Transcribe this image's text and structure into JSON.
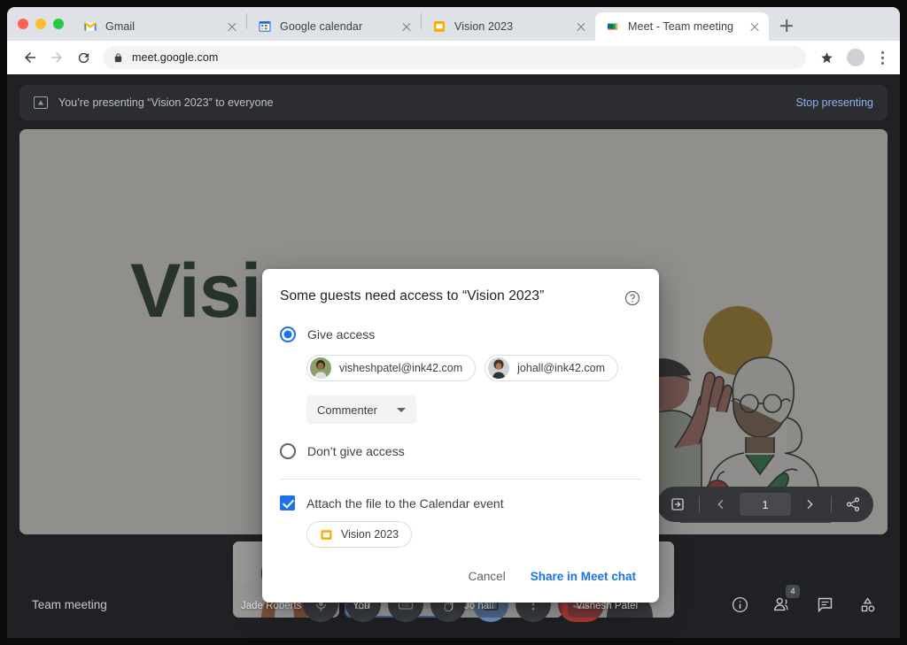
{
  "browser": {
    "tabs": [
      {
        "title": "Gmail",
        "icon": "gmail-icon",
        "active": false
      },
      {
        "title": "Google calendar",
        "icon": "google-calendar-icon",
        "active": false
      },
      {
        "title": "Vision 2023",
        "icon": "google-slides-icon",
        "active": false
      },
      {
        "title": "Meet - Team meeting",
        "icon": "google-meet-icon",
        "active": true
      }
    ],
    "new_tab_label": "+",
    "address": {
      "url": "meet.google.com",
      "lock_icon": "lock-icon",
      "back_icon": "back-arrow-icon",
      "forward_icon": "forward-arrow-icon",
      "reload_icon": "reload-icon",
      "bookmark_icon": "star-icon",
      "profile_icon": "profile-avatar-icon",
      "menu_icon": "three-dot-menu-icon"
    }
  },
  "meet": {
    "presenting_banner": {
      "icon": "present-screen-icon",
      "text": "You’re presenting “Vision 2023” to everyone",
      "stop_label": "Stop presenting"
    },
    "slide": {
      "title": "Visio",
      "page_number": "1",
      "nav": {
        "popout_icon": "open-in-new-icon",
        "prev_icon": "chevron-left-icon",
        "next_icon": "chevron-right-icon",
        "share_icon": "share-icon"
      }
    },
    "participants": [
      {
        "name": "Jade Roberts",
        "is_self": false,
        "speaking": false
      },
      {
        "name": "You",
        "is_self": true,
        "speaking": true
      },
      {
        "name": "Jo hall",
        "is_self": false,
        "speaking": false
      },
      {
        "name": "Vishesh Patel",
        "is_self": false,
        "speaking": false
      }
    ],
    "meeting_name": "Team meeting",
    "controls": [
      {
        "name": "microphone-button",
        "icon": "microphone-icon",
        "state": "on"
      },
      {
        "name": "camera-button",
        "icon": "video-camera-icon",
        "state": "on"
      },
      {
        "name": "captions-button",
        "icon": "closed-captions-icon",
        "state": "off"
      },
      {
        "name": "raise-hand-button",
        "icon": "raised-hand-icon",
        "state": "off"
      },
      {
        "name": "present-now-button",
        "icon": "present-screen-icon",
        "state": "active"
      },
      {
        "name": "more-options-button",
        "icon": "three-dot-menu-icon",
        "state": "off"
      },
      {
        "name": "leave-call-button",
        "icon": "end-call-icon",
        "state": "danger"
      }
    ],
    "right_controls": [
      {
        "name": "meeting-details-button",
        "icon": "info-icon",
        "badge": ""
      },
      {
        "name": "show-everyone-button",
        "icon": "people-icon",
        "badge": "4"
      },
      {
        "name": "chat-button",
        "icon": "chat-bubble-icon",
        "badge": ""
      },
      {
        "name": "activities-button",
        "icon": "activities-icon",
        "badge": ""
      }
    ]
  },
  "dialog": {
    "title": "Some guests need access to “Vision 2023”",
    "help_icon": "help-circle-icon",
    "options": [
      {
        "label": "Give access",
        "selected": true
      },
      {
        "label": "Don’t give access",
        "selected": false
      }
    ],
    "guests": [
      {
        "email": "visheshpatel@ink42.com",
        "avatar": "avatar-vishesh"
      },
      {
        "email": "johall@ink42.com",
        "avatar": "avatar-johall"
      }
    ],
    "role": {
      "value": "Commenter",
      "caret_icon": "chevron-down-icon"
    },
    "attach": {
      "label": "Attach the file to the Calendar event",
      "checked": true,
      "file_name": "Vision 2023",
      "file_icon": "google-slides-icon"
    },
    "actions": {
      "cancel": "Cancel",
      "confirm": "Share in Meet chat"
    }
  },
  "colors": {
    "accent_blue": "#1a73e8",
    "link_blue": "#8ab4f8",
    "slides_yellow": "#F9AB00",
    "danger_red": "#b33a34",
    "slide_title_green": "#0f2b1d",
    "sun_gold": "#ab8319"
  }
}
